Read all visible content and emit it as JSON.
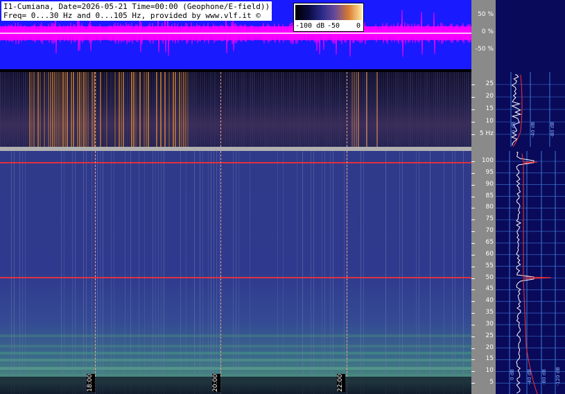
{
  "header": {
    "line1": "I1-Cumiana, Date=2026-05-21 Time=00:00 (Geophone/E-field))",
    "line2": "Freq= 0...30 Hz and 0...105 Hz, provided by www.vlf.it ©"
  },
  "colorbar": {
    "labels": [
      "-100 dB",
      "-50",
      "0"
    ]
  },
  "wave_scale": [
    "50 %",
    "0 %",
    "-50 %"
  ],
  "low_freq_ticks": [
    "25",
    "20",
    "15",
    "10",
    "5 Hz"
  ],
  "high_freq_ticks": [
    "100",
    "95",
    "90",
    "85",
    "80",
    "75",
    "70",
    "65",
    "60",
    "55",
    "50",
    "45",
    "40",
    "35",
    "30",
    "25",
    "20",
    "15",
    "10",
    "5"
  ],
  "time_labels": [
    "18:00",
    "20:00",
    "22:00"
  ],
  "right_panel_labels": {
    "top": [
      "0 dB",
      "-40 dB",
      "-80 dB"
    ],
    "bottom": [
      "0 dB",
      "-40 dB",
      "-80 dB",
      "-120 dB"
    ]
  },
  "colors": {
    "wave_bg": "#1a1aff",
    "wave_fg": "#ff00ff",
    "grid_red": "#ff3030",
    "panel_bg": "#0a0a5a"
  }
}
